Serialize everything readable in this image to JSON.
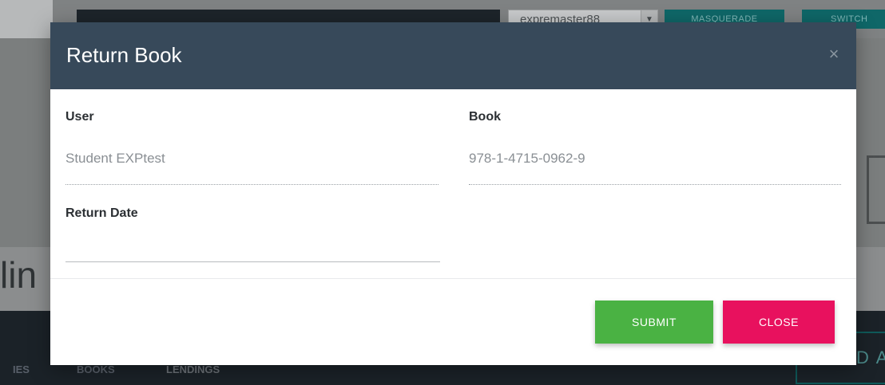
{
  "background": {
    "user_select": "expremaster88",
    "masquerade_label": "MASQUERADE",
    "switch_label": "SWITCH BAC",
    "heading_fragment": "lin",
    "nav_items": [
      "IES",
      "BOOKS",
      "LENDINGS"
    ],
    "add_button_fragment": "D A"
  },
  "modal": {
    "title": "Return Book",
    "close_icon": "×",
    "fields": {
      "user_label": "User",
      "user_value": "Student EXPtest",
      "book_label": "Book",
      "book_value": "978-1-4715-0962-9",
      "return_date_label": "Return Date",
      "return_date_value": ""
    },
    "buttons": {
      "submit": "SUBMIT",
      "close": "CLOSE"
    }
  },
  "colors": {
    "header": "#37495a",
    "submit": "#4ab243",
    "close": "#e8115e"
  }
}
